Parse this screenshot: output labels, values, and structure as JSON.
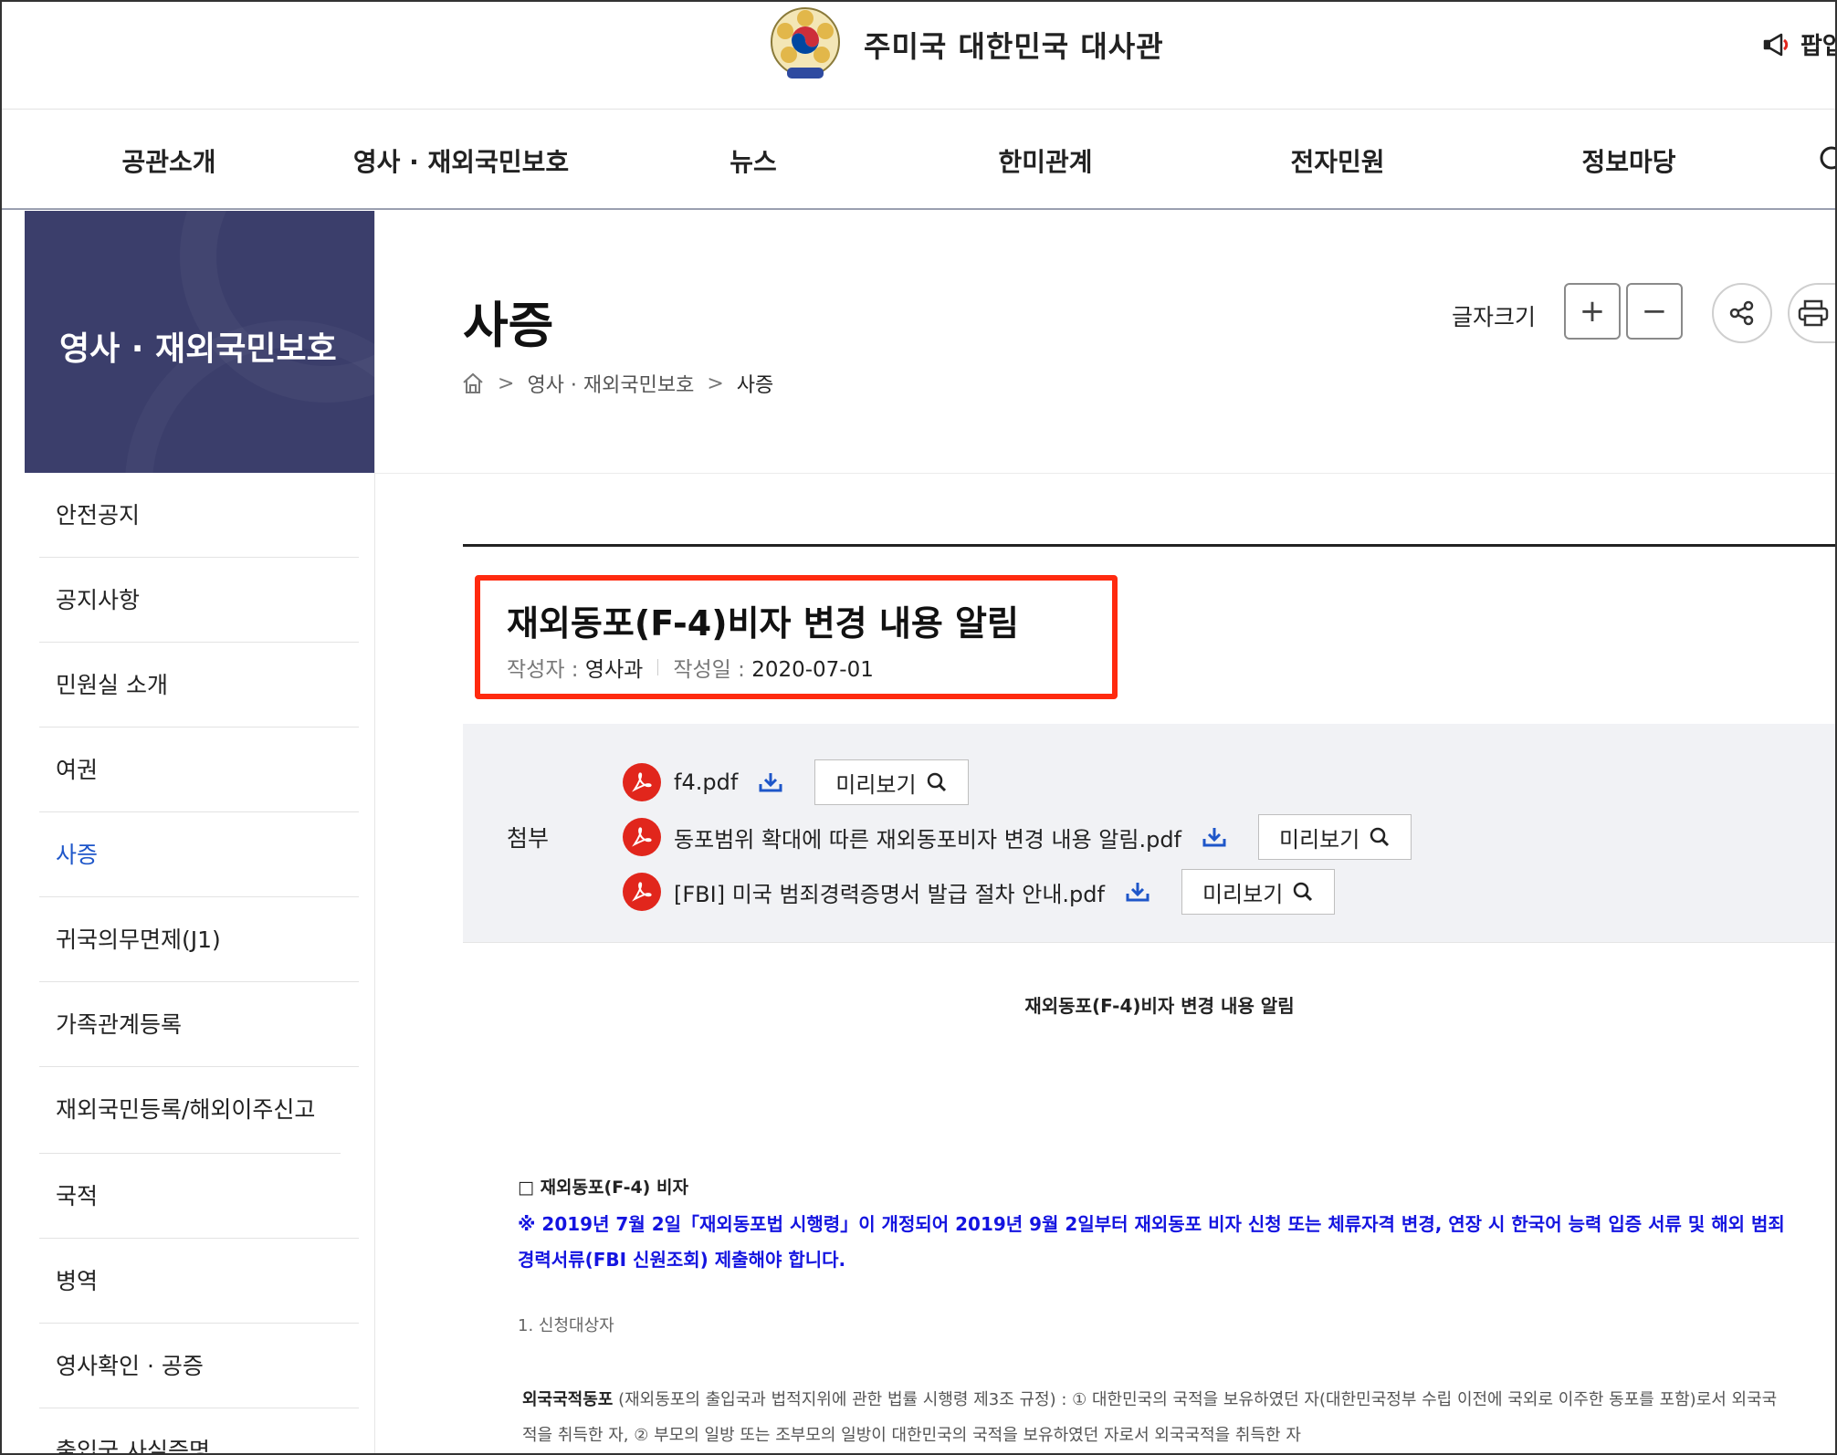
{
  "header": {
    "site_title": "주미국 대한민국 대사관",
    "popup_label": "팝업"
  },
  "gnb": {
    "items": [
      "공관소개",
      "영사 · 재외국민보호",
      "뉴스",
      "한미관계",
      "전자민원",
      "정보마당"
    ]
  },
  "sidebar": {
    "title": "영사 · 재외국민보호",
    "items": [
      {
        "label": "안전공지"
      },
      {
        "label": "공지사항"
      },
      {
        "label": "민원실 소개"
      },
      {
        "label": "여권"
      },
      {
        "label": "사증",
        "active": true
      },
      {
        "label": "귀국의무면제(J1)"
      },
      {
        "label": "가족관계등록"
      },
      {
        "label": "재외국민등록/해외이주신고"
      },
      {
        "label": "국적"
      },
      {
        "label": "병역"
      },
      {
        "label": "영사확인 · 공증"
      },
      {
        "label": "출입국 사실증명"
      }
    ]
  },
  "page": {
    "title": "사증",
    "breadcrumb": [
      "영사 · 재외국민보호",
      "사증"
    ],
    "font_size_label": "글자크기",
    "plus": "+",
    "minus": "−"
  },
  "article": {
    "title": "재외동포(F-4)비자 변경 내용 알림",
    "author_key": "작성자 :",
    "author": "영사과",
    "date_key": "작성일 :",
    "date": "2020-07-01",
    "attach_label": "첨부",
    "files": [
      {
        "name": "f4.pdf",
        "preview": "미리보기"
      },
      {
        "name": "동포범위 확대에 따른 재외동포비자 변경 내용 알림.pdf",
        "preview": "미리보기"
      },
      {
        "name": "[FBI] 미국 범죄경력증명서 발급 절차 안내.pdf",
        "preview": "미리보기"
      }
    ],
    "body_heading": "재외동포(F-4)비자 변경 내용 알림",
    "section_title": "□ 재외동포(F-4) 비자",
    "notice": "※  2019년 7월 2일「재외동포법 시행령」이 개정되어 2019년 9월 2일부터 재외동포 비자 신청 또는 체류자격 변경, 연장 시 한국어 능력 입증 서류 및 해외 범죄경력서류(FBI 신원조회) 제출해야 합니다.",
    "subsection": "1. 신청대상자",
    "para_bold": "외국국적동포",
    "para_text": " (재외동포의 출입국과 법적지위에 관한 법률 시행령 제3조 규정) : ① 대한민국의 국적을 보유하였던 자(대한민국정부 수립 이전에 국외로 이주한 동포를 포함)로서 외국국적을 취득한 자, ② 부모의 일방 또는 조부모의 일방이 대한민국의 국적을 보유하였던 자로서 외국국적을 취득한 자"
  },
  "colors": {
    "sidebar_header": "#3b3e6b",
    "active_link": "#1e56c9",
    "highlight_border": "#ff2a0f",
    "pdf_icon": "#e1261c",
    "notice_text": "#1414e0"
  }
}
